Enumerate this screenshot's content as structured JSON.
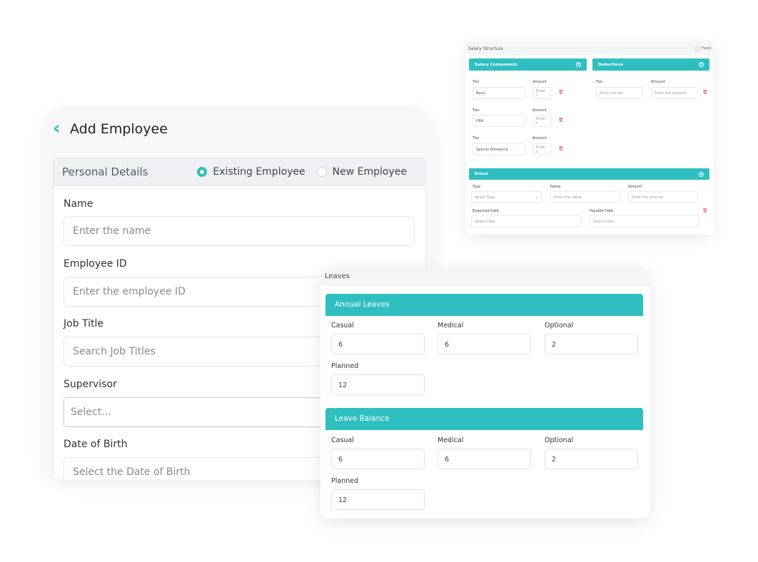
{
  "add_employee": {
    "title": "Add Employee",
    "personal_details": "Personal Details",
    "radio_existing": "Existing Employee",
    "radio_new": "New Employee",
    "name_label": "Name",
    "name_placeholder": "Enter the name",
    "emp_id_label": "Employee ID",
    "emp_id_placeholder": "Enter the employee ID",
    "job_title_label": "Job Title",
    "job_title_placeholder": "Search Job Titles",
    "supervisor_label": "Supervisor",
    "supervisor_placeholder": "Select...",
    "dob_label": "Date of Birth",
    "dob_placeholder": "Select the Date of Birth"
  },
  "salary_structure": {
    "title": "Salary Structure",
    "toggle_label": "Fixed",
    "components_title": "Salary Components",
    "deductions_title": "Deductions",
    "tier_label": "Tier",
    "amount_label": "Amount",
    "components": [
      "Basic",
      "HRA",
      "Special Allowance"
    ],
    "amount_placeholder": "Enter t",
    "deduction_tier_placeholder": "Enter the tier",
    "deduction_amount_placeholder": "Enter the amount",
    "bonus_title": "Bonus",
    "type_label": "Type",
    "type_placeholder": "Select Type",
    "name_label": "Name",
    "name_placeholder": "Enter the name",
    "bonus_amount_placeholder": "Enter the amount",
    "expected_date_label": "Expected Date",
    "payable_date_label": "Payable Date",
    "date_placeholder": "Select Date"
  },
  "leaves": {
    "title": "Leaves",
    "annual": {
      "title": "Annual Leaves",
      "casual_label": "Casual",
      "casual": "6",
      "medical_label": "Medical",
      "medical": "6",
      "optional_label": "Optional",
      "optional": "2",
      "planned_label": "Planned",
      "planned": "12"
    },
    "balance": {
      "title": "Leave Balance",
      "casual_label": "Casual",
      "casual": "6",
      "medical_label": "Medical",
      "medical": "6",
      "optional_label": "Optional",
      "optional": "2",
      "planned_label": "Planned",
      "planned": "12"
    }
  }
}
